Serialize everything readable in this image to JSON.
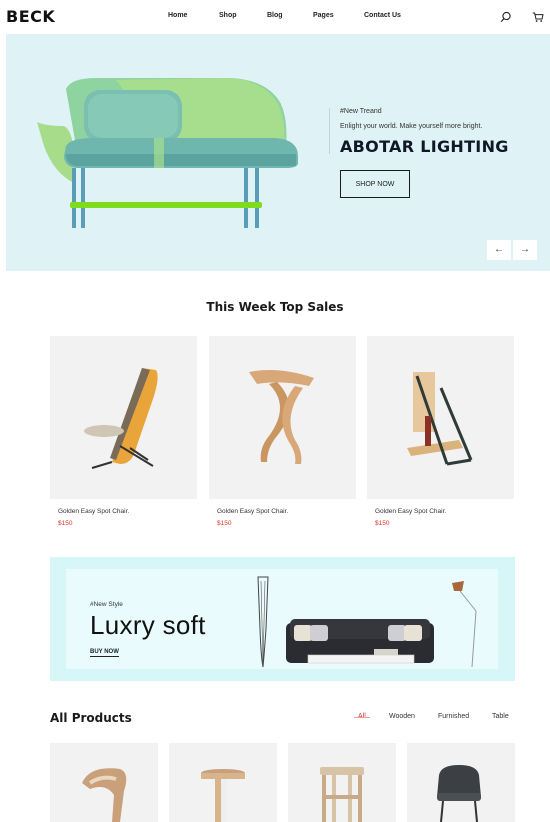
{
  "brand": {
    "logo": "BECK"
  },
  "nav": {
    "items": [
      "Home",
      "Shop",
      "Blog",
      "Pages",
      "Contact Us"
    ]
  },
  "header_icons": [
    "search-icon",
    "cart-icon"
  ],
  "hero": {
    "tag": "#New Treand",
    "subtitle": "Enlight your world. Make yourself more bright.",
    "title": "ABOTAR LIGHTING",
    "button": "SHOP NOW",
    "prev_arrow": "←",
    "next_arrow": "→"
  },
  "top_sales": {
    "title": "This Week Top Sales",
    "items": [
      {
        "name": "Golden Easy Spot Chair.",
        "price": "$150"
      },
      {
        "name": "Golden Easy Spot Chair.",
        "price": "$150"
      },
      {
        "name": "Golden Easy Spot Chair.",
        "price": "$150"
      }
    ]
  },
  "banner": {
    "tag": "#New Style",
    "title": "Luxry soft",
    "link": "BUY NOW"
  },
  "all_products": {
    "title": "All Products",
    "filters": [
      "All",
      "Wooden",
      "Furnished",
      "Table"
    ],
    "active_filter": "All"
  },
  "colors": {
    "hero_bg": "#dff3f6",
    "banner_bg": "#d7f6f8",
    "price": "#d7362b",
    "card_bg": "#f2f2f2"
  }
}
